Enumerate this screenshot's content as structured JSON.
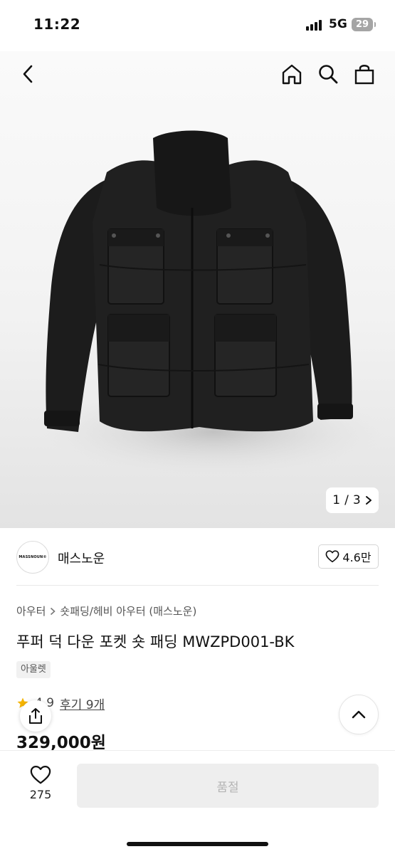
{
  "status_bar": {
    "time": "11:22",
    "network": "5G",
    "battery": "29"
  },
  "header": {
    "back_icon": "chevron-left-icon",
    "home_icon": "home-icon",
    "search_icon": "search-icon",
    "cart_icon": "shopping-bag-icon"
  },
  "gallery": {
    "current": "1",
    "separator": "/",
    "total": "3"
  },
  "seller": {
    "logo_text": "MASSNOUN©",
    "name": "매스노운",
    "likes": "4.6만"
  },
  "product": {
    "breadcrumb": [
      "아우터",
      "숏패딩/헤비 아우터 (매스노운)"
    ],
    "title": "푸퍼 덕 다운 포켓 숏 패딩 MWZPD001-BK",
    "tag": "아울렛",
    "rating": "4.9",
    "review_label": "후기 9개",
    "price": "329,000원"
  },
  "bottom_bar": {
    "wish_count": "275",
    "buy_label": "품절"
  },
  "colors": {
    "accent": "#111111",
    "soldout_bg": "#eeeeee",
    "soldout_text": "#b4b4b4",
    "star": "#f5b400"
  }
}
